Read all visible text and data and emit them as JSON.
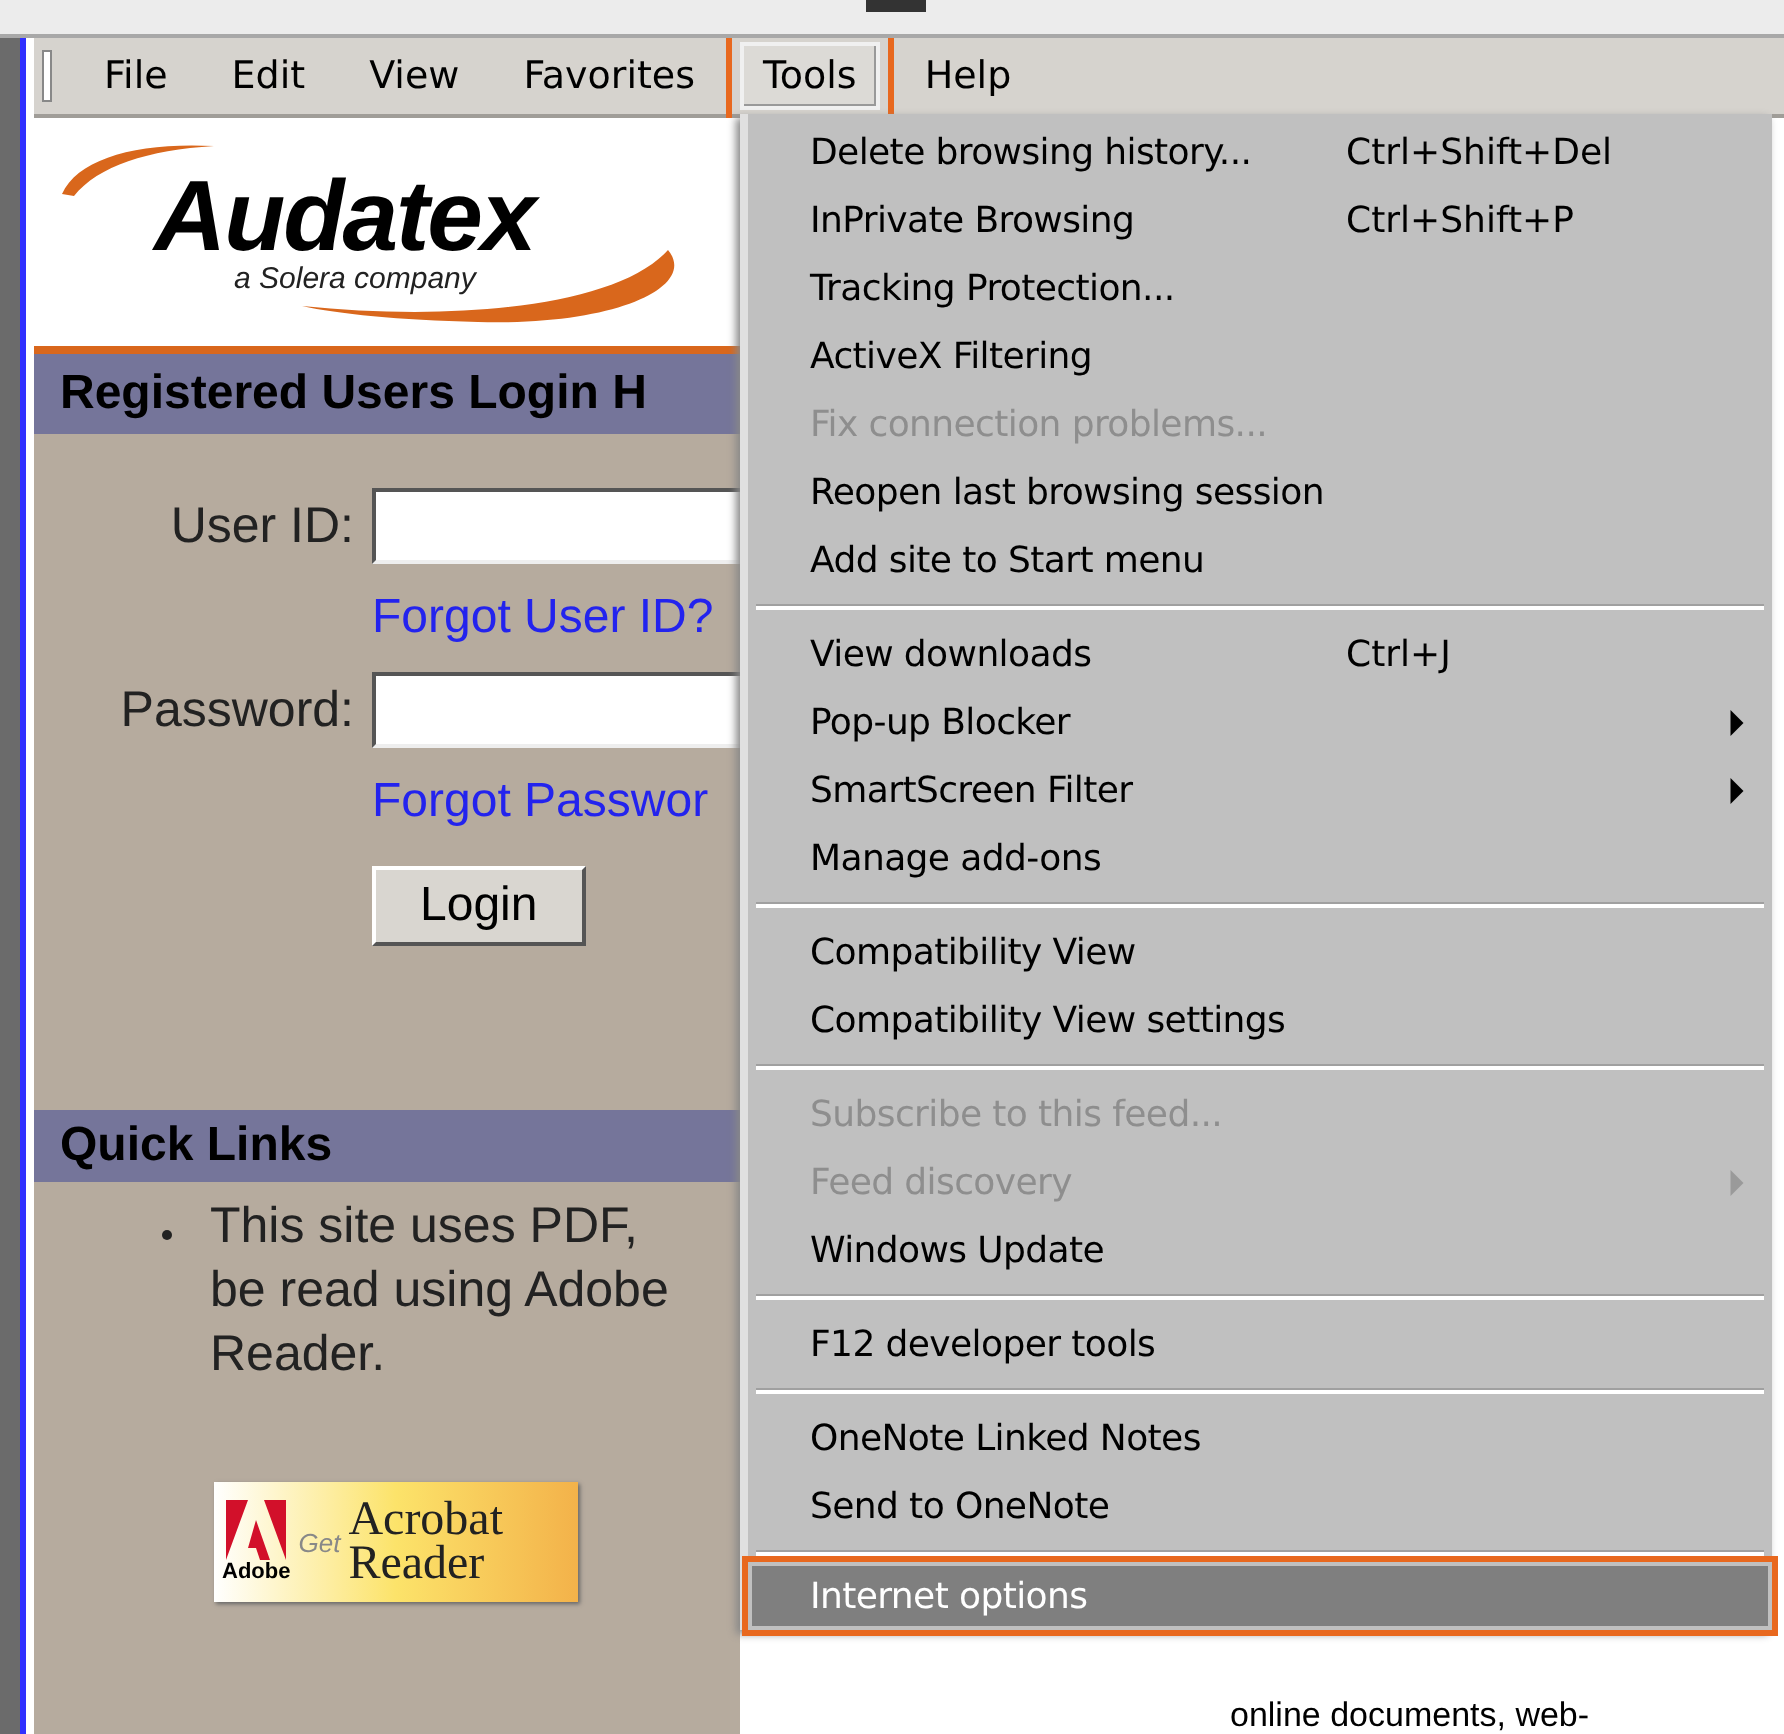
{
  "menubar": [
    {
      "label": "File",
      "selected": false
    },
    {
      "label": "Edit",
      "selected": false
    },
    {
      "label": "View",
      "selected": false
    },
    {
      "label": "Favorites",
      "selected": false
    },
    {
      "label": "Tools",
      "selected": true
    },
    {
      "label": "Help",
      "selected": false
    }
  ],
  "logo": {
    "name": "Audatex",
    "tagline": "a Solera company"
  },
  "login": {
    "heading": "Registered Users Login H",
    "fields": [
      {
        "label": "User ID:",
        "link": "Forgot User ID?"
      },
      {
        "label": "Password:",
        "link": "Forgot Passwor"
      }
    ],
    "button": "Login"
  },
  "quick_links": {
    "heading": "Quick Links",
    "bullet_lines": [
      "This site uses PDF,",
      "be read using Adobe",
      "Reader."
    ],
    "badge": {
      "brand": "Adobe",
      "get": "Get",
      "product": [
        "Acrobat",
        "Reader"
      ]
    }
  },
  "background_text": "online documents, web-",
  "tools_menu": [
    {
      "kind": "item",
      "label": "Delete browsing history...",
      "shortcut": "Ctrl+Shift+Del",
      "disabled": false,
      "submenu": false,
      "highlighted": false
    },
    {
      "kind": "item",
      "label": "InPrivate Browsing",
      "shortcut": "Ctrl+Shift+P",
      "disabled": false,
      "submenu": false,
      "highlighted": false
    },
    {
      "kind": "item",
      "label": "Tracking Protection...",
      "disabled": false,
      "submenu": false,
      "highlighted": false
    },
    {
      "kind": "item",
      "label": "ActiveX Filtering",
      "disabled": false,
      "submenu": false,
      "highlighted": false
    },
    {
      "kind": "item",
      "label": "Fix connection problems...",
      "disabled": true,
      "submenu": false,
      "highlighted": false
    },
    {
      "kind": "item",
      "label": "Reopen last browsing session",
      "disabled": false,
      "submenu": false,
      "highlighted": false
    },
    {
      "kind": "item",
      "label": "Add site to Start menu",
      "disabled": false,
      "submenu": false,
      "highlighted": false
    },
    {
      "kind": "separator"
    },
    {
      "kind": "item",
      "label": "View downloads",
      "shortcut": "Ctrl+J",
      "disabled": false,
      "submenu": false,
      "highlighted": false
    },
    {
      "kind": "item",
      "label": "Pop-up Blocker",
      "disabled": false,
      "submenu": true,
      "highlighted": false
    },
    {
      "kind": "item",
      "label": "SmartScreen Filter",
      "disabled": false,
      "submenu": true,
      "highlighted": false
    },
    {
      "kind": "item",
      "label": "Manage add-ons",
      "disabled": false,
      "submenu": false,
      "highlighted": false
    },
    {
      "kind": "separator"
    },
    {
      "kind": "item",
      "label": "Compatibility View",
      "disabled": false,
      "submenu": false,
      "highlighted": false
    },
    {
      "kind": "item",
      "label": "Compatibility View settings",
      "disabled": false,
      "submenu": false,
      "highlighted": false
    },
    {
      "kind": "separator"
    },
    {
      "kind": "item",
      "label": "Subscribe to this feed...",
      "disabled": true,
      "submenu": false,
      "highlighted": false
    },
    {
      "kind": "item",
      "label": "Feed discovery",
      "disabled": true,
      "submenu": true,
      "highlighted": false
    },
    {
      "kind": "item",
      "label": "Windows Update",
      "disabled": false,
      "submenu": false,
      "highlighted": false
    },
    {
      "kind": "separator"
    },
    {
      "kind": "item",
      "label": "F12 developer tools",
      "disabled": false,
      "submenu": false,
      "highlighted": false
    },
    {
      "kind": "separator"
    },
    {
      "kind": "item",
      "label": "OneNote Linked Notes",
      "disabled": false,
      "submenu": false,
      "highlighted": false
    },
    {
      "kind": "item",
      "label": "Send to OneNote",
      "disabled": false,
      "submenu": false,
      "highlighted": false
    },
    {
      "kind": "separator"
    },
    {
      "kind": "item",
      "label": "Internet options",
      "disabled": false,
      "submenu": false,
      "highlighted": true
    }
  ]
}
